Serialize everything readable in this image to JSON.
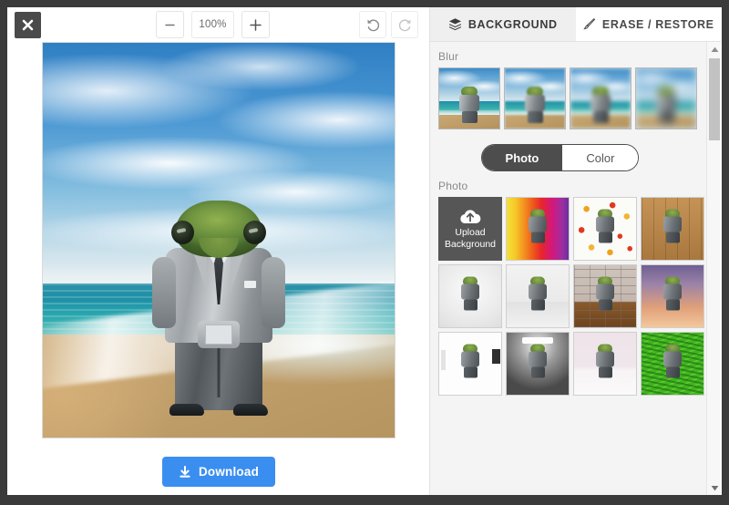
{
  "toolbar": {
    "close_label": "Close",
    "close_icon": "close-icon",
    "zoom_out_label": "−",
    "zoom_level": "100%",
    "zoom_in_label": "+",
    "undo_icon": "undo-icon",
    "redo_icon": "redo-icon"
  },
  "canvas": {
    "alt": "Turtle-headed figure in a grey suit standing on a beach",
    "download_label": "Download",
    "download_icon": "download-icon",
    "download_color": "#3a8ef0"
  },
  "panel": {
    "tabs": [
      {
        "label": "BACKGROUND",
        "icon": "layers-icon",
        "active": true
      },
      {
        "label": "ERASE / RESTORE",
        "icon": "brush-icon",
        "active": false
      }
    ],
    "blur": {
      "label": "Blur",
      "items": [
        {
          "name": "blur-none"
        },
        {
          "name": "blur-light"
        },
        {
          "name": "blur-medium"
        },
        {
          "name": "blur-heavy"
        }
      ]
    },
    "source_toggle": {
      "options": [
        {
          "label": "Photo",
          "active": true
        },
        {
          "label": "Color",
          "active": false
        }
      ]
    },
    "photo": {
      "label": "Photo",
      "upload": {
        "line1": "Upload",
        "line2": "Background",
        "icon": "cloud-upload-icon"
      },
      "items": [
        {
          "name": "bg-rainbow-stripes"
        },
        {
          "name": "bg-floral-dots"
        },
        {
          "name": "bg-wood-planks"
        },
        {
          "name": "bg-studio-light-grey"
        },
        {
          "name": "bg-studio-white"
        },
        {
          "name": "bg-brick-wall"
        },
        {
          "name": "bg-purple-sunset"
        },
        {
          "name": "bg-white-room"
        },
        {
          "name": "bg-spotlight-dark"
        },
        {
          "name": "bg-soft-pink"
        },
        {
          "name": "bg-green-grass"
        }
      ]
    },
    "scrollbar": {
      "up_icon": "triangle-up-icon",
      "down_icon": "triangle-down-icon"
    }
  }
}
